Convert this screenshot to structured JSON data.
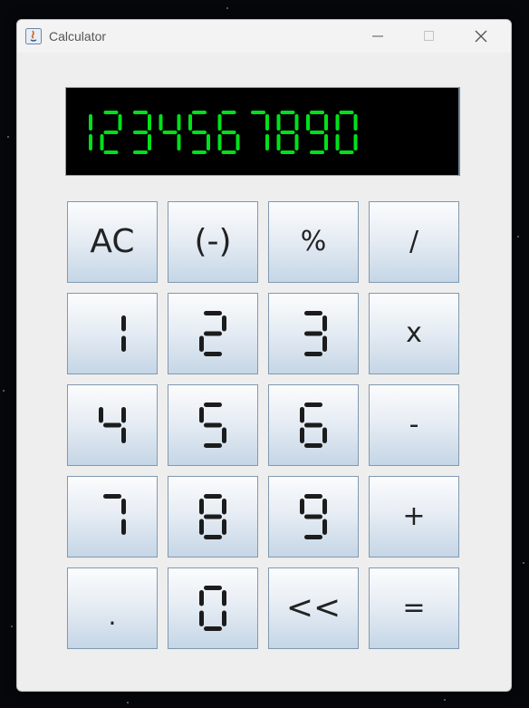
{
  "window": {
    "title": "Calculator",
    "accent": "#00e11a"
  },
  "display": {
    "value": "1234567890"
  },
  "keys": [
    {
      "label": "AC",
      "style": "text"
    },
    {
      "label": "(-)",
      "style": "text"
    },
    {
      "label": "%",
      "style": "text"
    },
    {
      "label": "/",
      "style": "text"
    },
    {
      "label": "1",
      "style": "seg"
    },
    {
      "label": "2",
      "style": "seg"
    },
    {
      "label": "3",
      "style": "seg"
    },
    {
      "label": "x",
      "style": "text"
    },
    {
      "label": "4",
      "style": "seg"
    },
    {
      "label": "5",
      "style": "seg"
    },
    {
      "label": "6",
      "style": "seg"
    },
    {
      "label": "-",
      "style": "text"
    },
    {
      "label": "7",
      "style": "seg"
    },
    {
      "label": "8",
      "style": "seg"
    },
    {
      "label": "9",
      "style": "seg"
    },
    {
      "label": "+",
      "style": "text"
    },
    {
      "label": ".",
      "style": "text"
    },
    {
      "label": "0",
      "style": "seg"
    },
    {
      "label": "<<",
      "style": "text"
    },
    {
      "label": "=",
      "style": "text"
    }
  ]
}
